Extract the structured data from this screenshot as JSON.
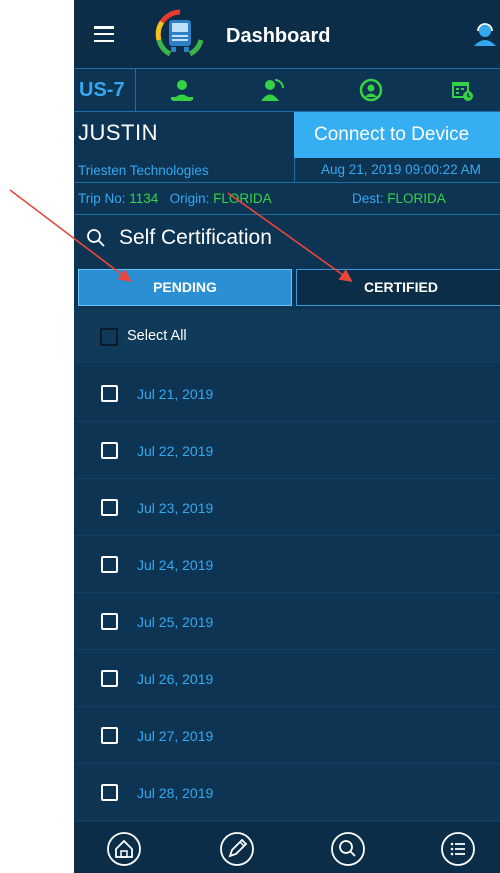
{
  "header": {
    "title": "Dashboard",
    "menu_icon": "hamburger-menu-icon",
    "logo_icon": "truck-logo-icon",
    "profile_icon": "driver-profile-icon"
  },
  "toolbar": {
    "unit_id": "US-7",
    "icons": [
      "driver-status-icon",
      "driver-refresh-icon",
      "sync-icon",
      "calendar-clock-icon"
    ]
  },
  "driver": {
    "name": "JUSTIN",
    "company": "Triesten Technologies"
  },
  "connect": {
    "label": "Connect to Device",
    "datetime": "Aug 21, 2019 09:00:22 AM"
  },
  "trip": {
    "trip_label": "Trip No:",
    "trip_no": "1134",
    "origin_label": "Origin:",
    "origin": "FLORIDA",
    "dest_label": "Dest:",
    "dest": "FLORIDA"
  },
  "section": {
    "title": "Self Certification",
    "icon": "search-icon"
  },
  "tabs": {
    "pending": "PENDING",
    "certified": "CERTIFIED",
    "active": "PENDING"
  },
  "select_all": {
    "label": "Select All",
    "checked": false
  },
  "dates": [
    {
      "label": "Jul 21, 2019",
      "checked": false
    },
    {
      "label": "Jul 22, 2019",
      "checked": false
    },
    {
      "label": "Jul 23, 2019",
      "checked": false
    },
    {
      "label": "Jul 24, 2019",
      "checked": false
    },
    {
      "label": "Jul 25, 2019",
      "checked": false
    },
    {
      "label": "Jul 26, 2019",
      "checked": false
    },
    {
      "label": "Jul 27, 2019",
      "checked": false
    },
    {
      "label": "Jul 28, 2019",
      "checked": false
    }
  ],
  "bottom_nav": [
    "home-icon",
    "pencil-edit-icon",
    "search-icon",
    "list-menu-icon"
  ],
  "colors": {
    "background": "#0d3453",
    "header": "#0b2d47",
    "accent_blue": "#36a8f0",
    "accent_green": "#35d246",
    "connect_button": "#35aef2",
    "annotation_arrow": "#e8473d"
  }
}
